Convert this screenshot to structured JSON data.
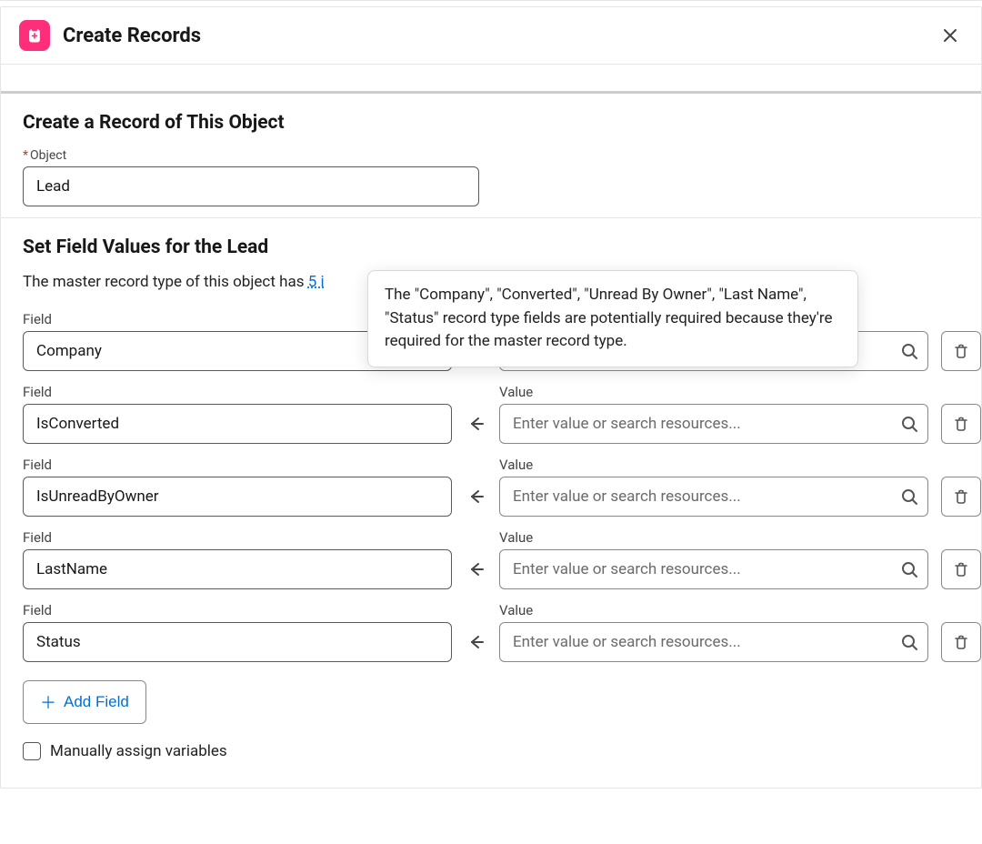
{
  "header": {
    "title": "Create Records"
  },
  "section_object": {
    "heading": "Create a Record of This Object",
    "object_label": "Object",
    "object_value": "Lead"
  },
  "section_fields": {
    "heading": "Set Field Values for the Lead",
    "note_prefix": "The master record type of this object has ",
    "note_link": "5 i",
    "field_col_label": "Field",
    "value_col_label": "Value",
    "value_placeholder": "Enter value or search resources...",
    "rows": [
      {
        "field": "Company"
      },
      {
        "field": "IsConverted"
      },
      {
        "field": "IsUnreadByOwner"
      },
      {
        "field": "LastName"
      },
      {
        "field": "Status"
      }
    ],
    "add_field_label": "Add Field",
    "manual_assign_label": "Manually assign variables",
    "manual_assign_checked": false
  },
  "tooltip": {
    "text": "The \"Company\", \"Converted\", \"Unread By Owner\", \"Last Name\", \"Status\" record type fields are potentially required because they're required for the master record type."
  }
}
